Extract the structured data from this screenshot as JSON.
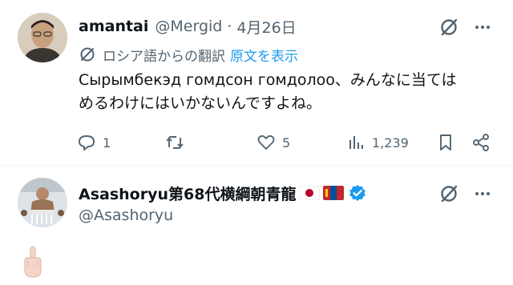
{
  "tweet": {
    "display_name": "amantai",
    "handle": "@Mergid",
    "separator": "·",
    "date": "4月26日",
    "translate_label": "ロシア語からの翻訳",
    "show_original_link": "原文を表示",
    "text_line1": "Сырымбекэд гомдсон гомдолоо、みんなに当ては",
    "text_line2": "めるわけにはいかないんですよね。",
    "actions": {
      "reply_count": "1",
      "retweet_count": "",
      "like_count": "5",
      "views_count": "1,239"
    }
  },
  "reply": {
    "display_name": "Asashoryu第68代横綱朝青龍",
    "handle": "@Asashoryu",
    "flags": [
      "japan-flag",
      "mongolia-flag"
    ],
    "verified_badge": "verified-icon",
    "emoji": "middle-finger"
  },
  "colors": {
    "text_primary": "#0f1419",
    "text_secondary": "#536471",
    "link": "#1d9bf0",
    "divider": "#eff3f4"
  }
}
